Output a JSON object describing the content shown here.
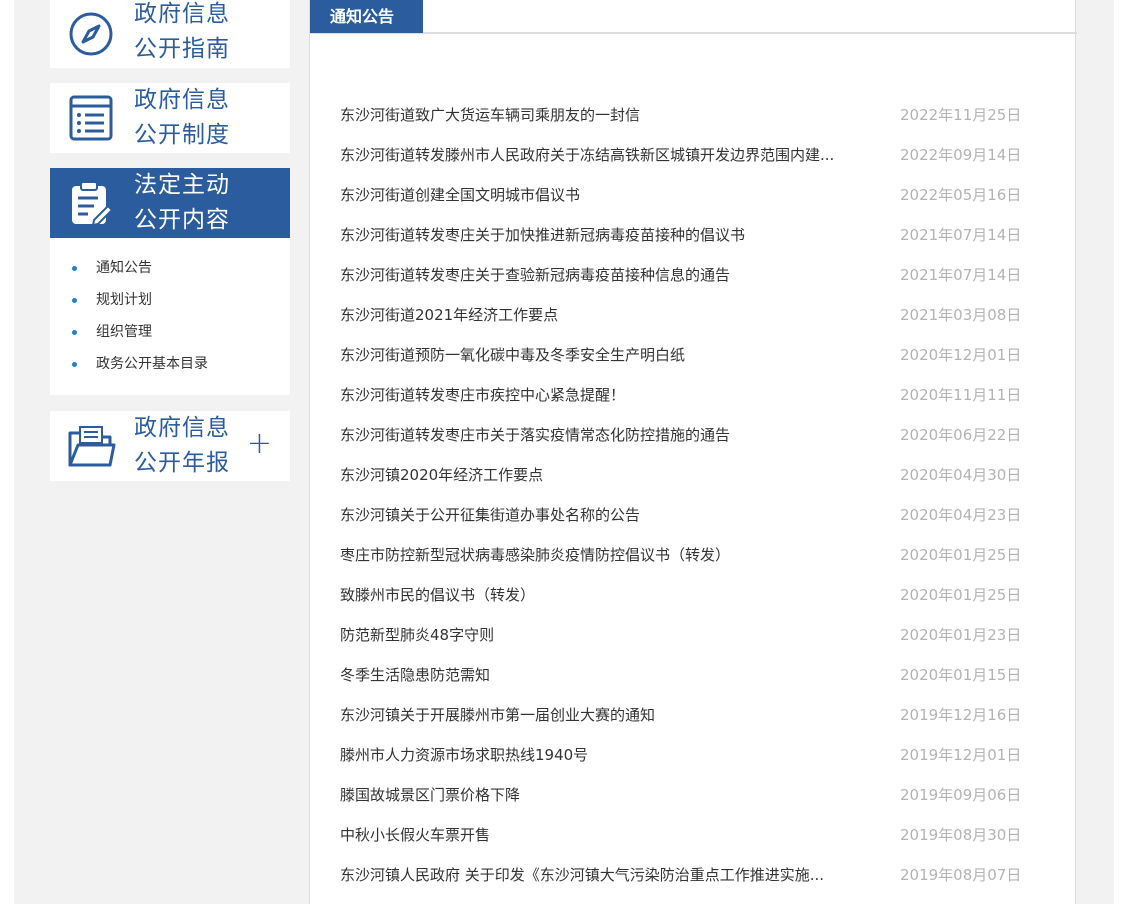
{
  "sidebar": {
    "guide": {
      "line1": "政府信息",
      "line2": "公开指南",
      "icon": "compass-icon"
    },
    "system": {
      "line1": "政府信息",
      "line2": "公开制度",
      "icon": "list-document-icon"
    },
    "statutory": {
      "line1": "法定主动",
      "line2": "公开内容",
      "icon": "clipboard-edit-icon"
    },
    "sub_items": [
      "通知公告",
      "规划计划",
      "组织管理",
      "政务公开基本目录"
    ],
    "annual": {
      "line1": "政府信息",
      "line2": "公开年报",
      "icon": "folder-icon",
      "expand": "+"
    }
  },
  "main": {
    "tab": "通知公告",
    "items": [
      {
        "title": "东沙河街道致广大货运车辆司乘朋友的一封信",
        "date": "2022年11月25日"
      },
      {
        "title": "东沙河街道转发滕州市人民政府关于冻结高铁新区城镇开发边界范围内建...",
        "date": "2022年09月14日"
      },
      {
        "title": "东沙河街道创建全国文明城市倡议书",
        "date": "2022年05月16日"
      },
      {
        "title": "东沙河街道转发枣庄关于加快推进新冠病毒疫苗接种的倡议书",
        "date": "2021年07月14日"
      },
      {
        "title": "东沙河街道转发枣庄关于查验新冠病毒疫苗接种信息的通告",
        "date": "2021年07月14日"
      },
      {
        "title": "东沙河街道2021年经济工作要点",
        "date": "2021年03月08日"
      },
      {
        "title": "东沙河街道预防一氧化碳中毒及冬季安全生产明白纸",
        "date": "2020年12月01日"
      },
      {
        "title": "东沙河街道转发枣庄市疾控中心紧急提醒！",
        "date": "2020年11月11日"
      },
      {
        "title": "东沙河街道转发枣庄市关于落实疫情常态化防控措施的通告",
        "date": "2020年06月22日"
      },
      {
        "title": "东沙河镇2020年经济工作要点",
        "date": "2020年04月30日"
      },
      {
        "title": "东沙河镇关于公开征集街道办事处名称的公告",
        "date": "2020年04月23日"
      },
      {
        "title": "枣庄市防控新型冠状病毒感染肺炎疫情防控倡议书（转发）",
        "date": "2020年01月25日"
      },
      {
        "title": "致滕州市民的倡议书（转发）",
        "date": "2020年01月25日"
      },
      {
        "title": "防范新型肺炎48字守则",
        "date": "2020年01月23日"
      },
      {
        "title": "冬季生活隐患防范需知",
        "date": "2020年01月15日"
      },
      {
        "title": "东沙河镇关于开展滕州市第一届创业大赛的通知",
        "date": "2019年12月16日"
      },
      {
        "title": "滕州市人力资源市场求职热线1940号",
        "date": "2019年12月01日"
      },
      {
        "title": "滕国故城景区门票价格下降",
        "date": "2019年09月06日"
      },
      {
        "title": "中秋小长假火车票开售",
        "date": "2019年08月30日"
      },
      {
        "title": "东沙河镇人民政府 关于印发《东沙河镇大气污染防治重点工作推进实施...",
        "date": "2019年08月07日"
      }
    ]
  },
  "colors": {
    "brand": "#2b5c9e",
    "date": "#b3b3b3",
    "bullet": "#2b7ad0"
  }
}
